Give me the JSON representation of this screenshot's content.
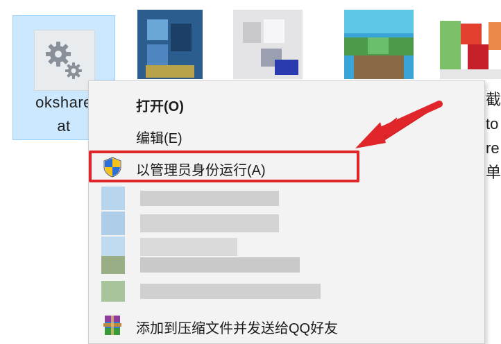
{
  "desktop": {
    "selected_file": {
      "label_line1": "okshare",
      "label_line2": "at",
      "icon": "gear-icon"
    },
    "other_icons": [
      {
        "name": "pixelated-app-icon-1"
      },
      {
        "name": "pixelated-app-icon-2"
      },
      {
        "name": "pixelated-app-icon-3"
      },
      {
        "name": "pixelated-app-icon-4"
      }
    ],
    "partial_text": [
      "截",
      "to",
      "re",
      "单"
    ]
  },
  "context_menu": {
    "items": [
      {
        "label": "打开(O)",
        "bold": true
      },
      {
        "label": "编辑(E)",
        "bold": false
      },
      {
        "label": "以管理员身份运行(A)",
        "icon": "uac-shield-icon"
      },
      {
        "label": "添加到压缩文件并发送给QQ好友",
        "icon": "winrar-icon"
      }
    ]
  },
  "annotation": {
    "color": "#e0262a",
    "arrow": "red-arrow-icon"
  }
}
